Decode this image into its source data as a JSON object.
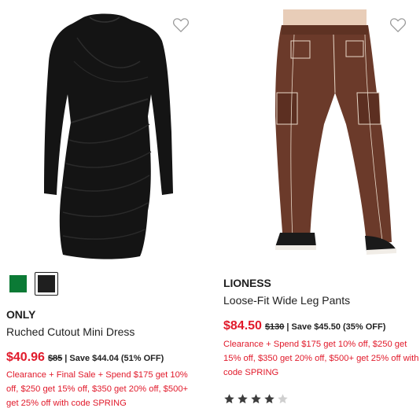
{
  "products": [
    {
      "brand": "ONLY",
      "name": "Ruched Cutout Mini Dress",
      "sale_price": "$40.96",
      "original_price": "$85",
      "save_text": "| Save $44.04 (51% OFF)",
      "promo": "Clearance + Final Sale + Spend $175 get 10% off, $250 get 15% off, $350 get 20% off, $500+ get 25% off with code SPRING",
      "image_icon": "black-long-sleeve-ruched-dress-image",
      "swatches": [
        {
          "color": "#0b7a35",
          "selected": false
        },
        {
          "color": "#1f1f1f",
          "selected": true
        }
      ]
    },
    {
      "brand": "LIONESS",
      "name": "Loose-Fit Wide Leg Pants",
      "sale_price": "$84.50",
      "original_price": "$130",
      "save_text": "| Save $45.50 (35% OFF)",
      "promo": "Clearance + Spend $175 get 10% off, $250 get 15% off, $350 get 20% off, $500+ get 25% off with code SPRING",
      "image_icon": "brown-cargo-pants-image",
      "rating": 4,
      "rating_max": 5
    }
  ],
  "colors": {
    "sale_red": "#e11a2b",
    "text": "#1f1f1f",
    "star_filled": "#3c3c3c",
    "star_empty": "#cfcfcf"
  },
  "icons": {
    "wishlist": "heart-outline-icon",
    "star": "star-icon"
  }
}
